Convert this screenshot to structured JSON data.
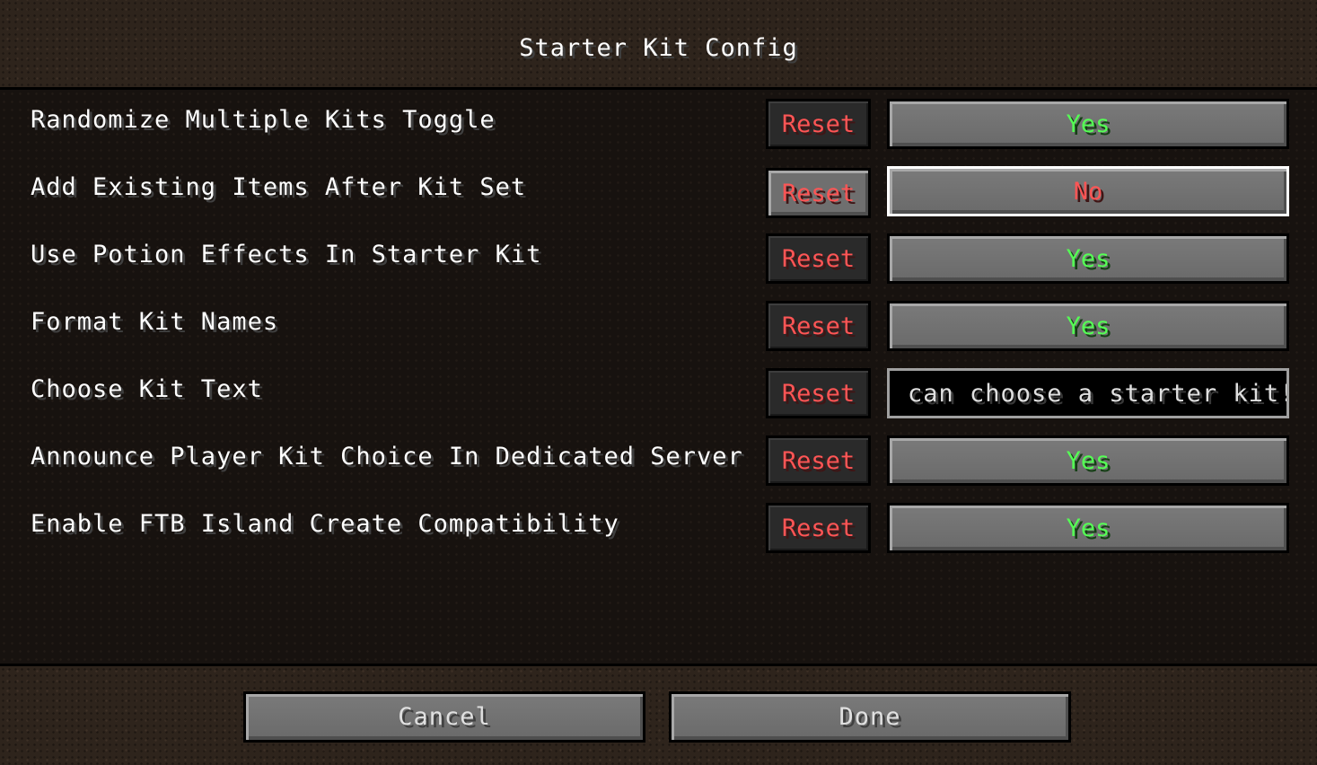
{
  "header": {
    "title": "Starter Kit Config"
  },
  "rows": [
    {
      "label": "Randomize Multiple Kits Toggle",
      "reset": "Reset",
      "type": "toggle",
      "value": "Yes"
    },
    {
      "label": "Add Existing Items After Kit Set",
      "reset": "Reset",
      "type": "toggle",
      "value": "No"
    },
    {
      "label": "Use Potion Effects In Starter Kit",
      "reset": "Reset",
      "type": "toggle",
      "value": "Yes"
    },
    {
      "label": "Format Kit Names",
      "reset": "Reset",
      "type": "toggle",
      "value": "Yes"
    },
    {
      "label": "Choose Kit Text",
      "reset": "Reset",
      "type": "text",
      "value": "can choose a starter kit!"
    },
    {
      "label": "Announce Player Kit Choice In Dedicated Server",
      "reset": "Reset",
      "type": "toggle",
      "value": "Yes"
    },
    {
      "label": "Enable FTB Island Create Compatibility",
      "reset": "Reset",
      "type": "toggle",
      "value": "Yes"
    }
  ],
  "footer": {
    "cancel_label": "Cancel",
    "done_label": "Done"
  },
  "colors": {
    "yes": "#55ff55",
    "no": "#ff5555",
    "reset": "#ff5555"
  }
}
